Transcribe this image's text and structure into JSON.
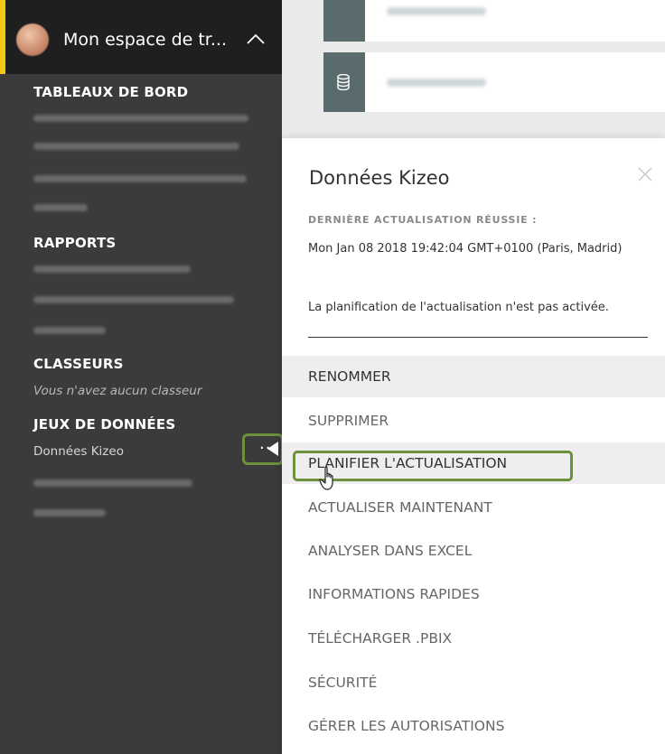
{
  "sidebar": {
    "workspace_title": "Mon espace de tr...",
    "sections": {
      "dashboards": "TABLEAUX DE BORD",
      "reports": "RAPPORTS",
      "workbooks": "CLASSEURS",
      "workbooks_empty": "Vous n'avez aucun classeur",
      "datasets": "JEUX DE DONNÉES"
    },
    "datasets_items": [
      "Données Kizeo"
    ],
    "more_options_label": "···",
    "accent_color": "#f2c811"
  },
  "popup": {
    "title": "Données Kizeo",
    "last_refresh_label": "DERNIÈRE ACTUALISATION RÉUSSIE :",
    "last_refresh_value": "Mon Jan 08 2018 19:42:04 GMT+0100 (Paris, Madrid)",
    "schedule_status": "La planification de l'actualisation n'est pas activée.",
    "menu": [
      "RENOMMER",
      "SUPPRIMER",
      "PLANIFIER L'ACTUALISATION",
      "ACTUALISER MAINTENANT",
      "ANALYSER DANS EXCEL",
      "INFORMATIONS RAPIDES",
      "TÉLÉCHARGER .PBIX",
      "SÉCURITÉ",
      "GÉRER LES AUTORISATIONS"
    ]
  },
  "highlight_color": "#6e8f3c",
  "icons": {
    "workspace_toggle": "chevron-up-icon",
    "close": "close-icon",
    "dataset_tile": "database-icon",
    "cursor": "hand-pointer-icon"
  }
}
